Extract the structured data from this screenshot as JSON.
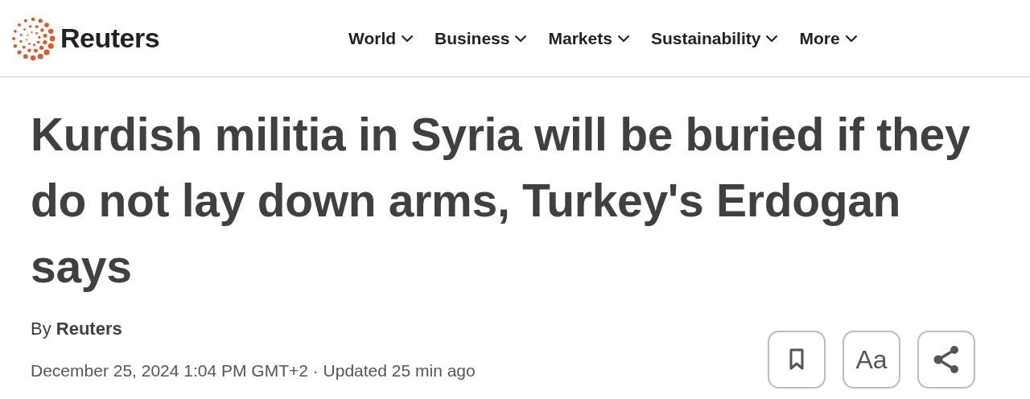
{
  "logo": {
    "text": "Reuters"
  },
  "nav": [
    {
      "label": "World"
    },
    {
      "label": "Business"
    },
    {
      "label": "Markets"
    },
    {
      "label": "Sustainability"
    },
    {
      "label": "More"
    }
  ],
  "headline": "Kurdish militia in Syria will be buried if they do not lay down arms, Turkey's Erdogan says",
  "byline": "By **Reuters**",
  "dateline": "December 25, 2024 1:04 PM GMT+2 · Updated 25 min ago",
  "actions": [
    {
      "kind": "bookmark"
    },
    {
      "kind": "text-size",
      "label": "Aa"
    },
    {
      "kind": "share"
    }
  ]
}
